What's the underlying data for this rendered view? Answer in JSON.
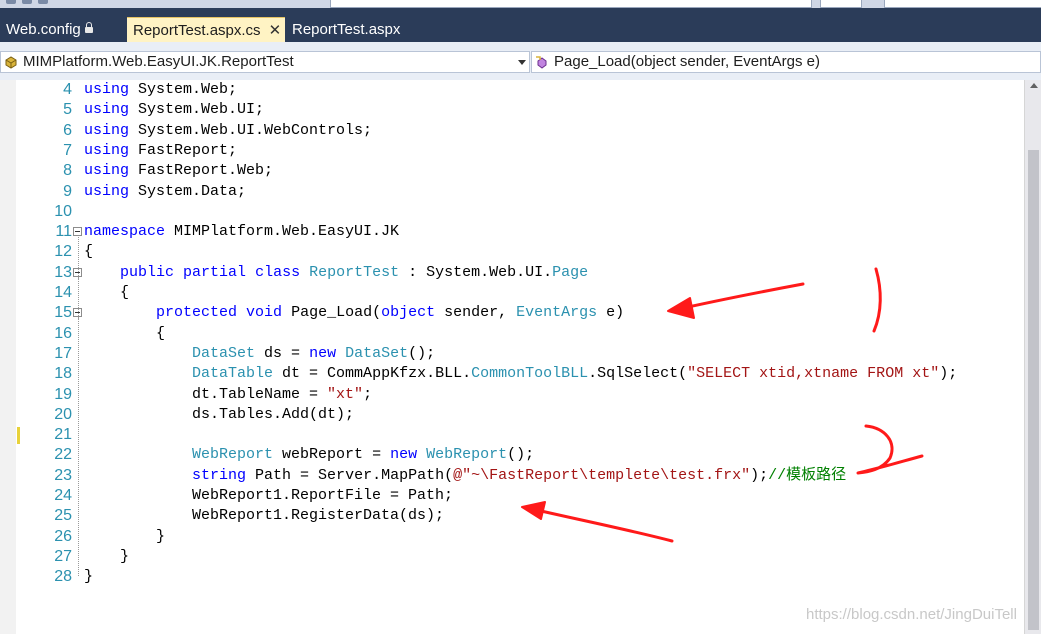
{
  "tabs": [
    {
      "label": "Web.config",
      "locked": true,
      "active": false
    },
    {
      "label": "ReportTest.aspx.cs",
      "active": true
    },
    {
      "label": "ReportTest.aspx",
      "active": false
    }
  ],
  "nav": {
    "type_selector": "MIMPlatform.Web.EasyUI.JK.ReportTest",
    "member_selector": "Page_Load(object sender, EventArgs e)"
  },
  "code_lines": [
    {
      "num": "4",
      "parts": [
        [
          "kw",
          "using"
        ],
        [
          "pl",
          " System.Web;"
        ]
      ]
    },
    {
      "num": "5",
      "parts": [
        [
          "kw",
          "using"
        ],
        [
          "pl",
          " System.Web.UI;"
        ]
      ]
    },
    {
      "num": "6",
      "parts": [
        [
          "kw",
          "using"
        ],
        [
          "pl",
          " System.Web.UI.WebControls;"
        ]
      ]
    },
    {
      "num": "7",
      "parts": [
        [
          "kw",
          "using"
        ],
        [
          "pl",
          " FastReport;"
        ]
      ]
    },
    {
      "num": "8",
      "parts": [
        [
          "kw",
          "using"
        ],
        [
          "pl",
          " FastReport.Web;"
        ]
      ]
    },
    {
      "num": "9",
      "parts": [
        [
          "kw",
          "using"
        ],
        [
          "pl",
          " System.Data;"
        ]
      ]
    },
    {
      "num": "10",
      "parts": []
    },
    {
      "num": "11",
      "parts": [
        [
          "kw",
          "namespace"
        ],
        [
          "pl",
          " MIMPlatform.Web.EasyUI.JK"
        ]
      ]
    },
    {
      "num": "12",
      "parts": [
        [
          "pl",
          "{"
        ]
      ]
    },
    {
      "num": "13",
      "parts": [
        [
          "pl",
          "    "
        ],
        [
          "kw",
          "public"
        ],
        [
          "pl",
          " "
        ],
        [
          "kw",
          "partial"
        ],
        [
          "pl",
          " "
        ],
        [
          "kw",
          "class"
        ],
        [
          "pl",
          " "
        ],
        [
          "ty",
          "ReportTest"
        ],
        [
          "pl",
          " : System.Web.UI."
        ],
        [
          "ty",
          "Page"
        ]
      ]
    },
    {
      "num": "14",
      "parts": [
        [
          "pl",
          "    {"
        ]
      ]
    },
    {
      "num": "15",
      "parts": [
        [
          "pl",
          "        "
        ],
        [
          "kw",
          "protected"
        ],
        [
          "pl",
          " "
        ],
        [
          "kw",
          "void"
        ],
        [
          "pl",
          " Page_Load("
        ],
        [
          "kw",
          "object"
        ],
        [
          "pl",
          " sender, "
        ],
        [
          "ty",
          "EventArgs"
        ],
        [
          "pl",
          " e)"
        ]
      ]
    },
    {
      "num": "16",
      "parts": [
        [
          "pl",
          "        {"
        ]
      ]
    },
    {
      "num": "17",
      "parts": [
        [
          "pl",
          "            "
        ],
        [
          "ty",
          "DataSet"
        ],
        [
          "pl",
          " ds = "
        ],
        [
          "kw",
          "new"
        ],
        [
          "pl",
          " "
        ],
        [
          "ty",
          "DataSet"
        ],
        [
          "pl",
          "();"
        ]
      ]
    },
    {
      "num": "18",
      "parts": [
        [
          "pl",
          "            "
        ],
        [
          "ty",
          "DataTable"
        ],
        [
          "pl",
          " dt = CommAppKfzx.BLL."
        ],
        [
          "ty",
          "CommonToolBLL"
        ],
        [
          "pl",
          ".SqlSelect("
        ],
        [
          "str",
          "\"SELECT xtid,xtname FROM xt\""
        ],
        [
          "pl",
          ");"
        ]
      ]
    },
    {
      "num": "19",
      "parts": [
        [
          "pl",
          "            dt.TableName = "
        ],
        [
          "str",
          "\"xt\""
        ],
        [
          "pl",
          ";"
        ]
      ]
    },
    {
      "num": "20",
      "parts": [
        [
          "pl",
          "            ds.Tables.Add(dt);"
        ]
      ]
    },
    {
      "num": "21",
      "parts": []
    },
    {
      "num": "22",
      "parts": [
        [
          "pl",
          "            "
        ],
        [
          "ty",
          "WebReport"
        ],
        [
          "pl",
          " webReport = "
        ],
        [
          "kw",
          "new"
        ],
        [
          "pl",
          " "
        ],
        [
          "ty",
          "WebReport"
        ],
        [
          "pl",
          "();"
        ]
      ]
    },
    {
      "num": "23",
      "parts": [
        [
          "pl",
          "            "
        ],
        [
          "kw",
          "string"
        ],
        [
          "pl",
          " Path = Server.MapPath("
        ],
        [
          "str",
          "@\"~\\FastReport\\templete\\test.frx\""
        ],
        [
          "pl",
          ");"
        ],
        [
          "cm",
          "//模板路径"
        ]
      ]
    },
    {
      "num": "24",
      "parts": [
        [
          "pl",
          "            WebReport1.ReportFile = Path;"
        ]
      ]
    },
    {
      "num": "25",
      "parts": [
        [
          "pl",
          "            WebReport1.RegisterData(ds);"
        ]
      ]
    },
    {
      "num": "26",
      "parts": [
        [
          "pl",
          "        }"
        ]
      ]
    },
    {
      "num": "27",
      "parts": [
        [
          "pl",
          "    }"
        ]
      ]
    },
    {
      "num": "28",
      "parts": [
        [
          "pl",
          "}"
        ]
      ]
    }
  ],
  "watermark": "https://blog.csdn.net/JingDuiTell",
  "colors": {
    "keyword": "#0000ff",
    "type": "#2b91af",
    "string": "#a31515",
    "comment": "#008000",
    "line_number": "#2b91af",
    "tab_bar": "#2b3c59",
    "active_tab": "#fff3c4",
    "annotation": "#ff1a1a"
  },
  "icons": [
    "lock-icon",
    "close-icon",
    "class-icon",
    "method-icon",
    "dropdown-arrow-icon"
  ]
}
